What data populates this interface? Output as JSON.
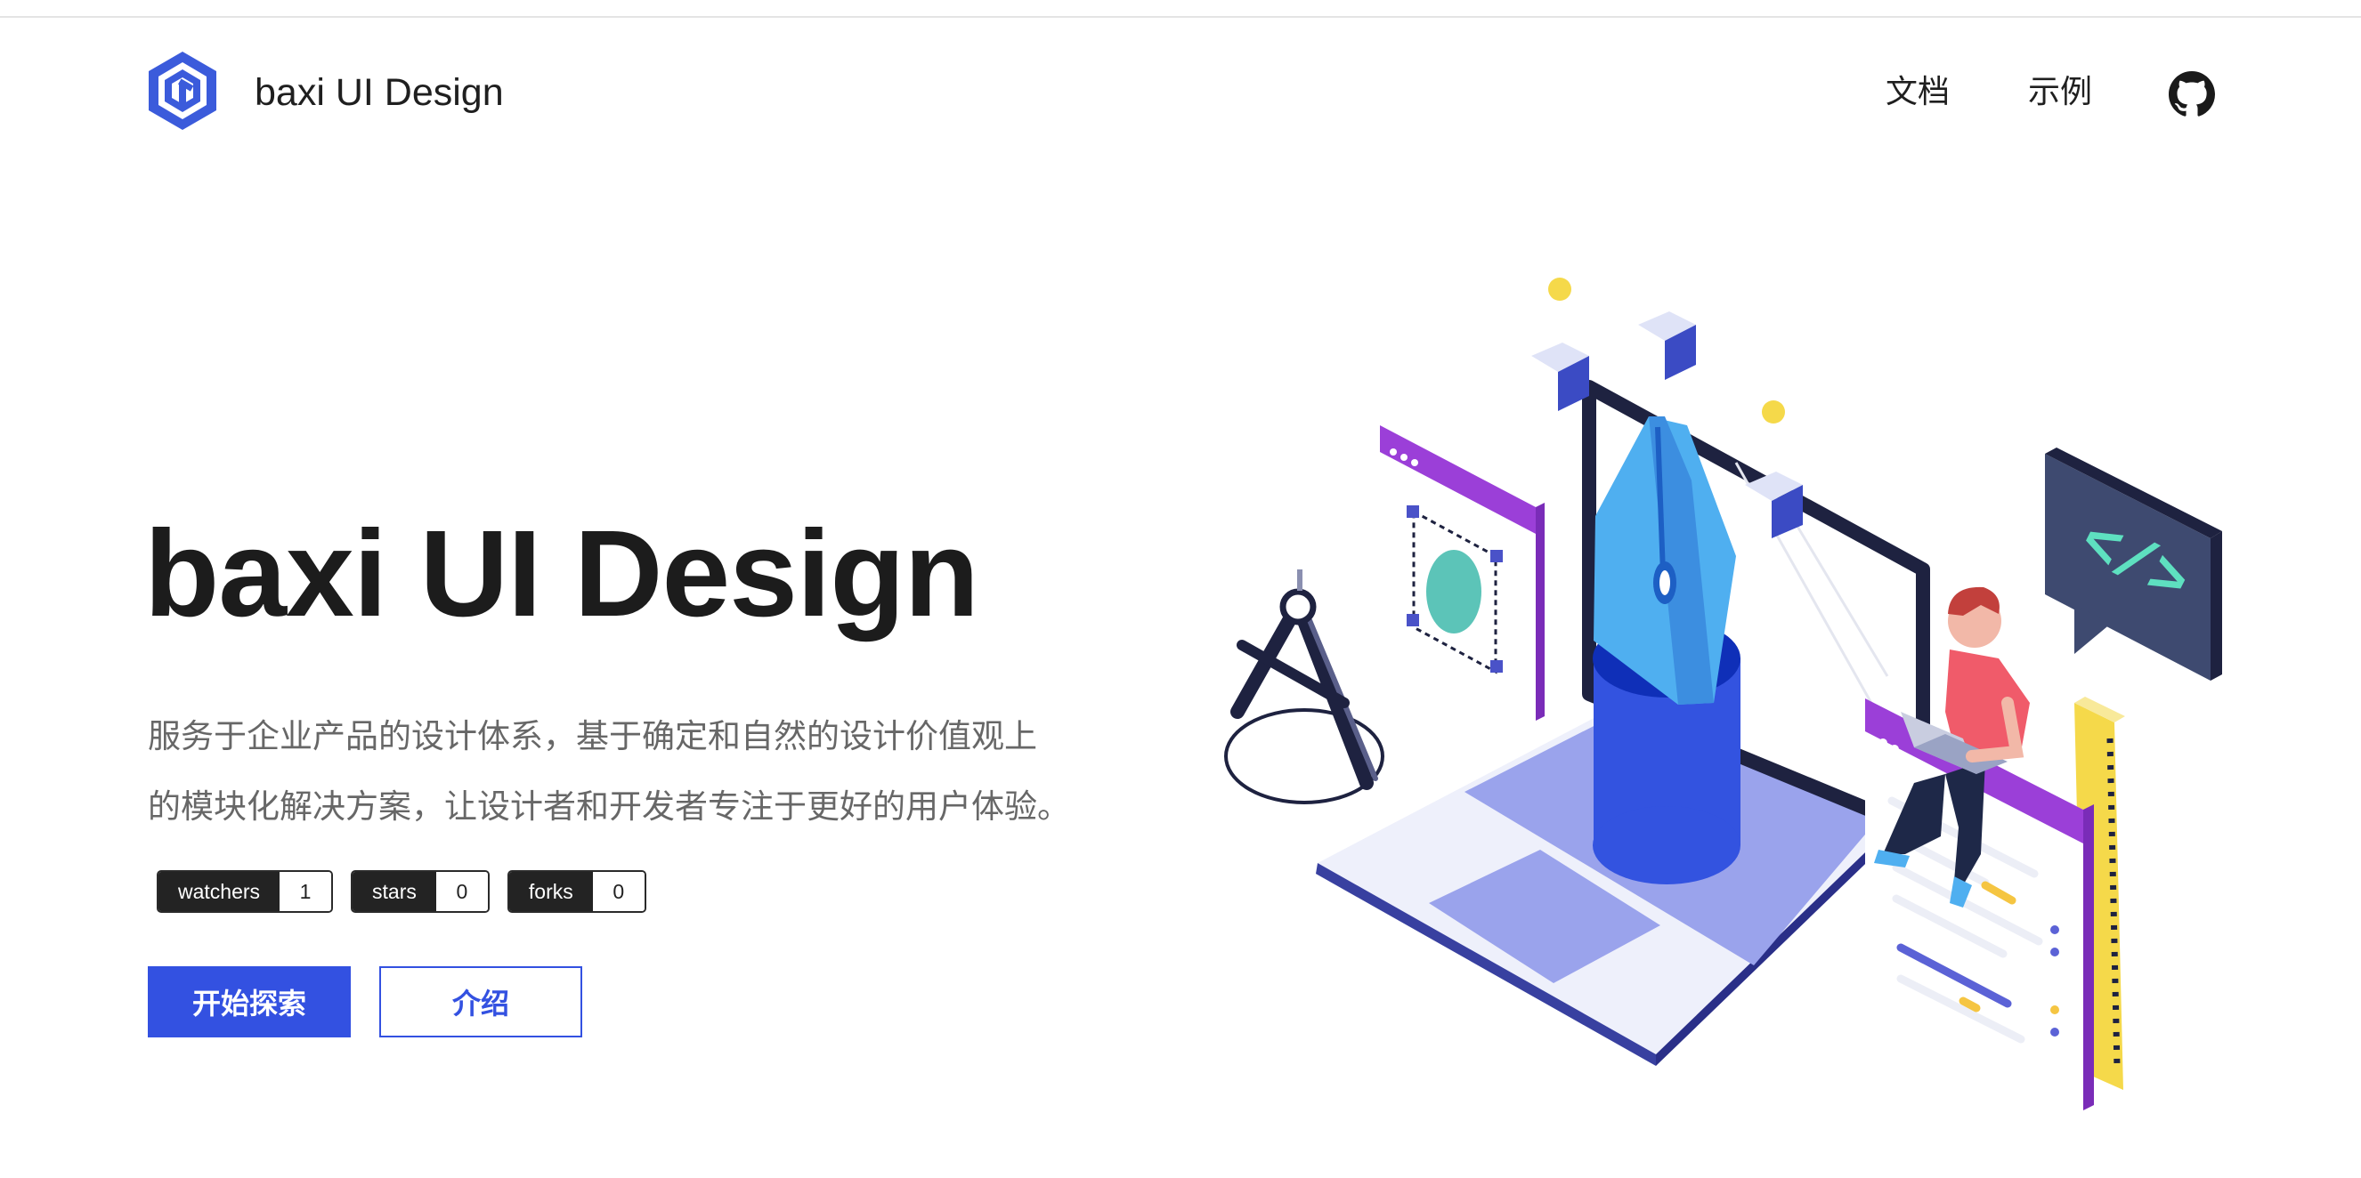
{
  "header": {
    "brand_name": "baxi UI Design",
    "logo_icon": "hexagon-logo-icon",
    "nav": [
      {
        "label": "文档"
      },
      {
        "label": "示例"
      }
    ],
    "github_icon": "github-icon"
  },
  "hero": {
    "title": "baxi UI Design",
    "description_line1": "服务于企业产品的设计体系，基于确定和自然的设计价值观上",
    "description_line2": "的模块化解决方案，让设计者和开发者专注于更好的用户体验。",
    "badges": [
      {
        "key": "watchers",
        "value": "1"
      },
      {
        "key": "stars",
        "value": "0"
      },
      {
        "key": "forks",
        "value": "0"
      }
    ],
    "primary_button": "开始探索",
    "secondary_button": "介绍",
    "illustration_icon": "design-tools-illustration-icon"
  },
  "colors": {
    "accent": "#3351e1",
    "text_dark": "#1c1c1c",
    "text_muted": "#676767",
    "badge_dark": "#232323",
    "purple": "#9b3fd8",
    "yellow": "#f5d94a",
    "sky": "#4faff0"
  }
}
